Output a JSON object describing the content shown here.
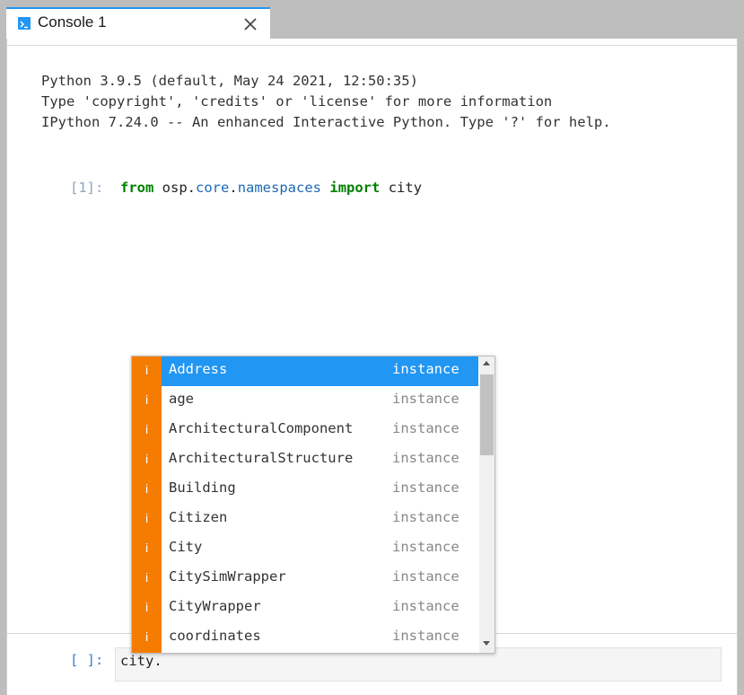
{
  "tab": {
    "title": "Console 1",
    "icon": "terminal-icon",
    "close_icon": "close-icon",
    "accent": "#2196f3"
  },
  "banner": [
    "Python 3.9.5 (default, May 24 2021, 12:50:35)",
    "Type 'copyright', 'credits' or 'license' for more information",
    "IPython 7.24.0 -- An enhanced Interactive Python. Type '?' for help."
  ],
  "cell1": {
    "prompt": "[1]:",
    "kw_from": "from",
    "module_a": "osp",
    "dot1": ".",
    "module_b": "core",
    "dot2": ".",
    "module_c": "namespaces",
    "kw_import": "import",
    "name": "city"
  },
  "input": {
    "prompt": "[ ]:",
    "value": "city."
  },
  "completer": {
    "type_icon_glyph": "i",
    "type_icon_color": "#f57c00",
    "selected_color": "#2196f3",
    "items": [
      {
        "name": "Address",
        "kind": "instance"
      },
      {
        "name": "age",
        "kind": "instance"
      },
      {
        "name": "ArchitecturalComponent",
        "kind": "instance"
      },
      {
        "name": "ArchitecturalStructure",
        "kind": "instance"
      },
      {
        "name": "Building",
        "kind": "instance"
      },
      {
        "name": "Citizen",
        "kind": "instance"
      },
      {
        "name": "City",
        "kind": "instance"
      },
      {
        "name": "CitySimWrapper",
        "kind": "instance"
      },
      {
        "name": "CityWrapper",
        "kind": "instance"
      },
      {
        "name": "coordinates",
        "kind": "instance"
      }
    ]
  }
}
